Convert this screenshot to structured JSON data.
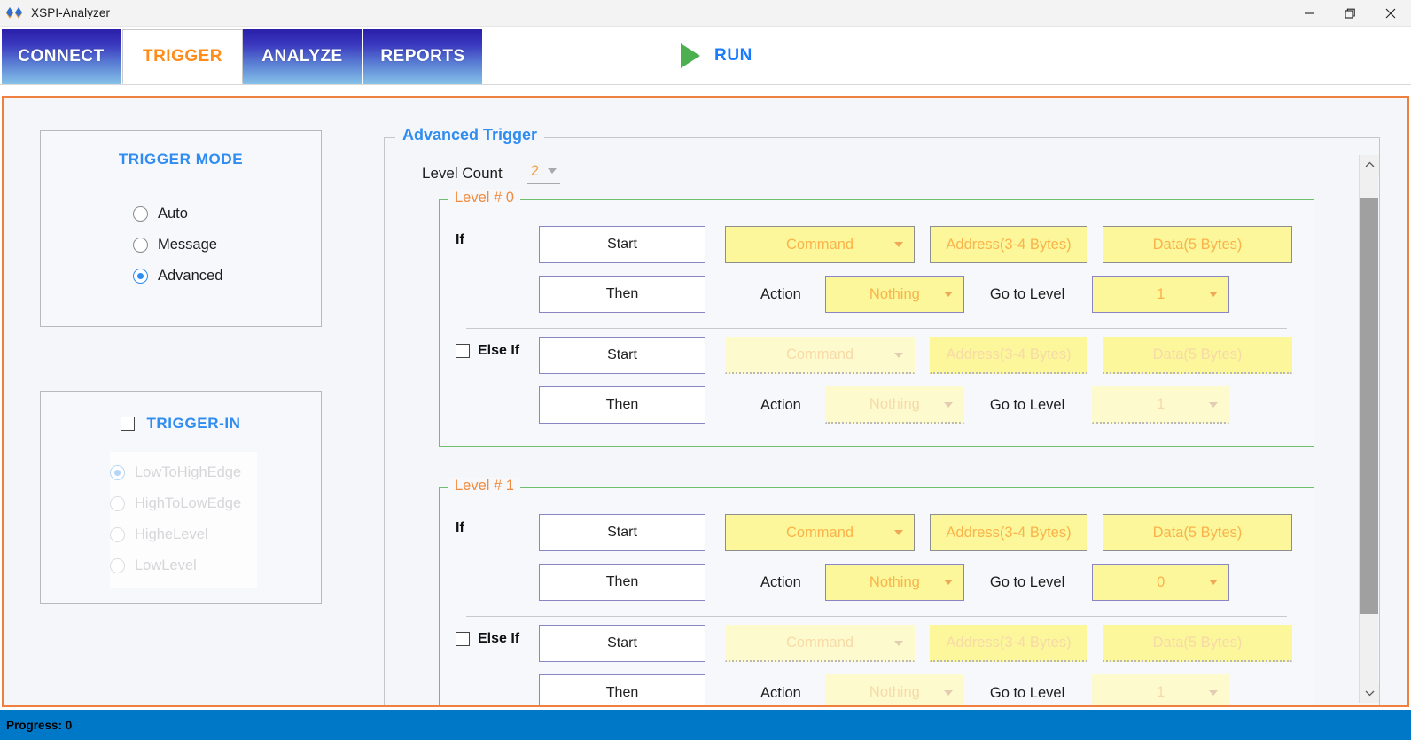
{
  "window": {
    "title": "XSPI-Analyzer",
    "icon": "double-diamond-logo",
    "controls": {
      "minimize": "—",
      "restore": "❐",
      "close": "✕"
    }
  },
  "tabs": [
    {
      "label": "CONNECT",
      "active": false
    },
    {
      "label": "TRIGGER",
      "active": true
    },
    {
      "label": "ANALYZE",
      "active": false
    },
    {
      "label": "REPORTS",
      "active": false
    }
  ],
  "run": {
    "label": "RUN",
    "icon": "play-icon"
  },
  "trigger_mode": {
    "title": "TRIGGER MODE",
    "options": [
      {
        "label": "Auto",
        "selected": false
      },
      {
        "label": "Message",
        "selected": false
      },
      {
        "label": "Advanced",
        "selected": true
      }
    ]
  },
  "trigger_in": {
    "title": "TRIGGER-IN",
    "checked": false,
    "enabled": false,
    "options": [
      {
        "label": "LowToHighEdge",
        "selected": true
      },
      {
        "label": "HighToLowEdge",
        "selected": false
      },
      {
        "label": "HigheLevel",
        "selected": false
      },
      {
        "label": "LowLevel",
        "selected": false
      }
    ]
  },
  "advanced_trigger": {
    "legend": "Advanced Trigger",
    "level_count_label": "Level Count",
    "level_count_value": "2",
    "labels": {
      "if": "If",
      "else_if": "Else If",
      "start": "Start",
      "then": "Then",
      "action": "Action",
      "goto": "Go to Level"
    },
    "placeholders": {
      "command": "Command",
      "address": "Address(3-4 Bytes)",
      "data": "Data(5 Bytes)"
    },
    "levels": [
      {
        "legend": "Level # 0",
        "if": {
          "start": "Start",
          "command": "Command",
          "address": "Address(3-4 Bytes)",
          "data": "Data(5 Bytes)",
          "then": "Then",
          "action": "Nothing",
          "goto": "1",
          "enabled": true
        },
        "else_if": {
          "checked": false,
          "start": "Start",
          "command": "Command",
          "address": "Address(3-4 Bytes)",
          "data": "Data(5 Bytes)",
          "then": "Then",
          "action": "Nothing",
          "goto": "1",
          "enabled": false
        }
      },
      {
        "legend": "Level # 1",
        "if": {
          "start": "Start",
          "command": "Command",
          "address": "Address(3-4 Bytes)",
          "data": "Data(5 Bytes)",
          "then": "Then",
          "action": "Nothing",
          "goto": "0",
          "enabled": true
        },
        "else_if": {
          "checked": false,
          "start": "Start",
          "command": "Command",
          "address": "Address(3-4 Bytes)",
          "data": "Data(5 Bytes)",
          "then": "Then",
          "action": "Nothing",
          "goto": "1",
          "enabled": false
        }
      }
    ]
  },
  "statusbar": {
    "text": "Progress: 0"
  },
  "colors": {
    "accent_orange": "#f08040",
    "accent_blue": "#2f8cf0",
    "field_yellow": "#fbf79a",
    "field_text_orange": "#fbb24a",
    "level_border_green": "#6ec06e",
    "button_border_purple": "#8a86c4",
    "status_blue": "#0078c8",
    "run_green": "#4caf50"
  }
}
